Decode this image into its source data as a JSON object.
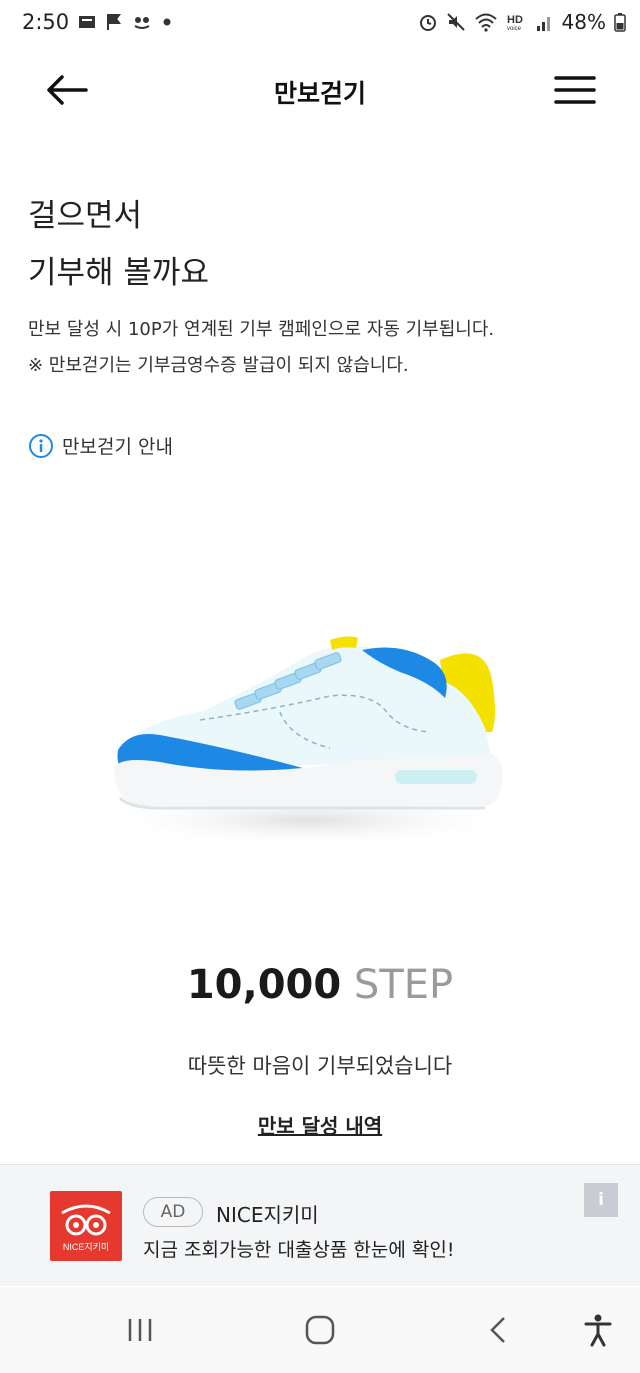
{
  "status_bar": {
    "time": "2:50",
    "battery_percent": "48%",
    "left_icons": [
      "notification-icon",
      "flag-icon",
      "app-icon",
      "dot-icon"
    ],
    "right_icons": [
      "alarm-icon",
      "mute-icon",
      "wifi-icon",
      "hd-voice-icon",
      "signal-icon",
      "battery-icon"
    ]
  },
  "app_bar": {
    "title": "만보걷기",
    "back_icon": "arrow-left-icon",
    "menu_icon": "hamburger-menu-icon"
  },
  "intro": {
    "headline_line1": "걸으면서",
    "headline_line2": "기부해 볼까요",
    "description_line1": "만보 달성 시 10P가 연계된 기부 캠페인으로 자동 기부됩니다.",
    "description_line2": "※ 만보걷기는 기부금영수증 발급이 되지 않습니다.",
    "guide_label": "만보걷기 안내",
    "guide_icon": "info-circle-icon"
  },
  "progress": {
    "steps": "10,000",
    "unit": "STEP",
    "message": "따뜻한 마음이 기부되었습니다",
    "history_link": "만보 달성 내역"
  },
  "ad": {
    "badge": "AD",
    "advertiser": "NICE지키미",
    "copy": "지금 조회가능한 대출상품 한눈에 확인!",
    "logo_text": "NICE지키미",
    "info_label": "i"
  },
  "nav_bar": {
    "items": [
      "recent-apps-icon",
      "home-icon",
      "back-icon",
      "accessibility-icon"
    ]
  },
  "colors": {
    "accent_blue": "#1e88e5",
    "shoe_body": "#eaf8fb",
    "shoe_yellow": "#f5e100",
    "ad_red": "#e5392f"
  }
}
